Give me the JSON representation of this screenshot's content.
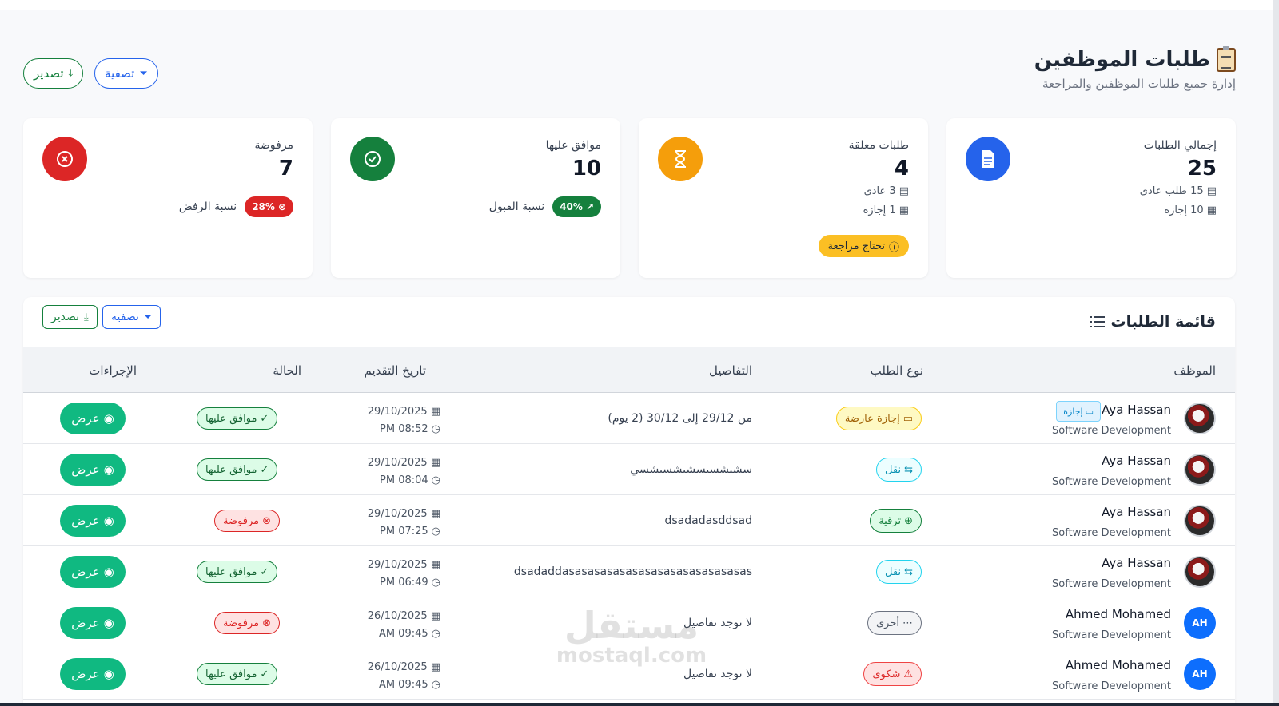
{
  "header": {
    "title": "طلبات الموظفين",
    "subtitle": "إدارة جميع طلبات الموظفين والمراجعة",
    "filter_label": "تصفية",
    "export_label": "تصدير"
  },
  "cards": {
    "total": {
      "label": "إجمالي الطلبات",
      "value": "25",
      "normal": "15 طلب عادي",
      "leave": "10 إجازة",
      "color": "#2563eb"
    },
    "pending": {
      "label": "طلبات معلقة",
      "value": "4",
      "normal": "3 عادي",
      "leave": "1 إجازة",
      "badge": "تحتاج مراجعة",
      "color": "#f59e0b"
    },
    "approved": {
      "label": "موافق عليها",
      "value": "10",
      "rate_label": "نسبة القبول",
      "rate": "40%",
      "color": "#15803d"
    },
    "rejected": {
      "label": "مرفوضة",
      "value": "7",
      "rate_label": "نسبة الرفض",
      "rate": "28%",
      "color": "#dc2626"
    }
  },
  "panel": {
    "title": "قائمة الطلبات",
    "filter_label": "تصفية",
    "export_label": "تصدير",
    "columns": {
      "employee": "الموظف",
      "type": "نوع الطلب",
      "details": "التفاصيل",
      "date": "تاريخ التقديم",
      "status": "الحالة",
      "actions": "الإجراءات"
    },
    "rows": [
      {
        "name": "Aya Hassan",
        "dept": "Software Development",
        "leave_tag": "إجازة",
        "type": "إجازة عارضة",
        "details": "من 29/12 إلى 30/12 (2 يوم)",
        "date": "29/10/2025",
        "time": "PM 08:52",
        "status": "موافق عليها",
        "action": "عرض"
      },
      {
        "name": "Aya Hassan",
        "dept": "Software Development",
        "type": "نقل",
        "details": "سشيشسيسشيشسيشسي",
        "date": "29/10/2025",
        "time": "PM 08:04",
        "status": "موافق عليها",
        "action": "عرض"
      },
      {
        "name": "Aya Hassan",
        "dept": "Software Development",
        "type": "ترقية",
        "details": "dsadadasddsad",
        "date": "29/10/2025",
        "time": "PM 07:25",
        "status": "مرفوضة",
        "action": "عرض"
      },
      {
        "name": "Aya Hassan",
        "dept": "Software Development",
        "type": "نقل",
        "details": "dsadaddasasasasasasasasasasasasasasas",
        "date": "29/10/2025",
        "time": "PM 06:49",
        "status": "موافق عليها",
        "action": "عرض"
      },
      {
        "name": "Ahmed Mohamed",
        "initials": "AH",
        "dept": "Software Development",
        "type": "أخرى",
        "details": "لا توجد تفاصيل",
        "date": "26/10/2025",
        "time": "AM 09:45",
        "status": "مرفوضة",
        "action": "عرض"
      },
      {
        "name": "Ahmed Mohamed",
        "initials": "AH",
        "dept": "Software Development",
        "type": "شكوى",
        "details": "لا توجد تفاصيل",
        "date": "26/10/2025",
        "time": "AM 09:45",
        "status": "موافق عليها",
        "action": "عرض"
      }
    ]
  },
  "watermark": {
    "line1": "مستقل",
    "line2": "mostaql.com"
  }
}
